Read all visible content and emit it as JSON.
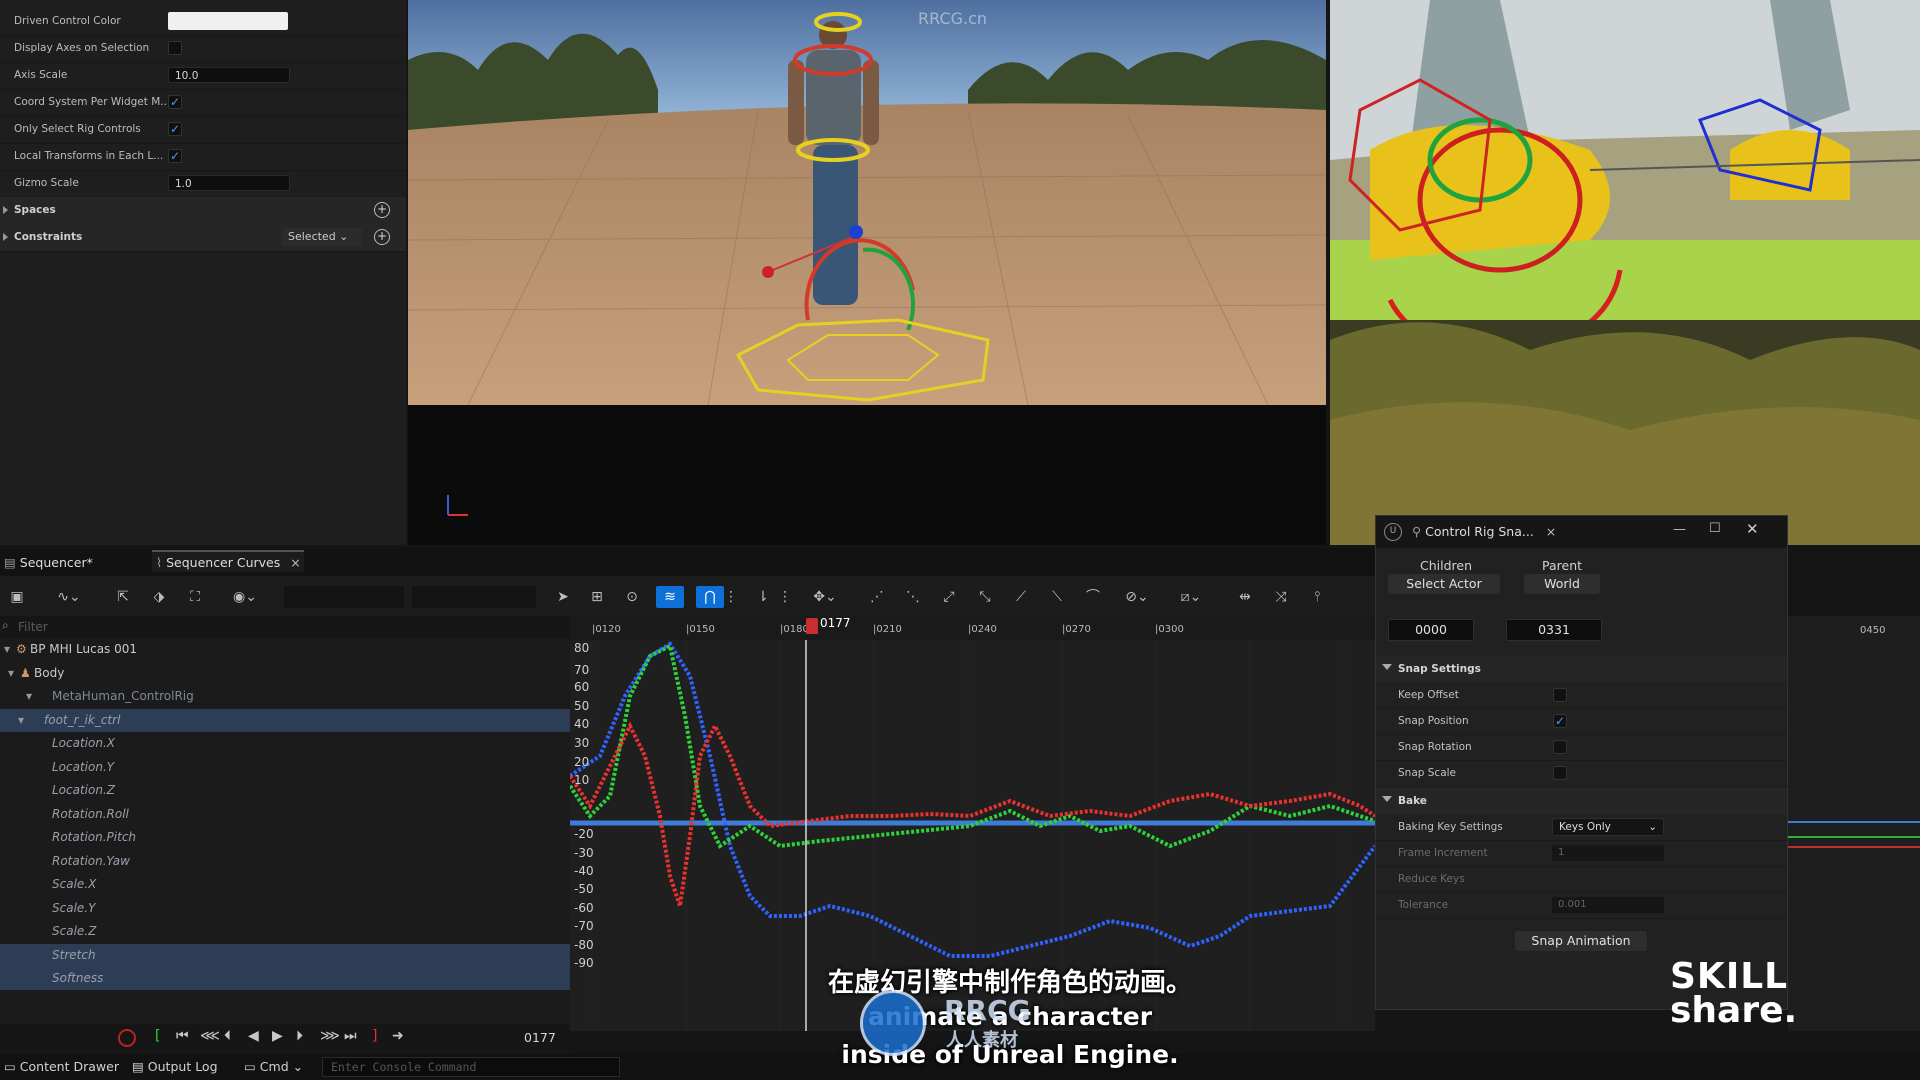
{
  "details": {
    "rows": [
      {
        "label": "Driven Control Color",
        "type": "color"
      },
      {
        "label": "Display Axes on Selection",
        "type": "check",
        "checked": false
      },
      {
        "label": "Axis Scale",
        "type": "value",
        "value": "10.0"
      },
      {
        "label": "Coord System Per Widget M...",
        "type": "check",
        "checked": true
      },
      {
        "label": "Only Select Rig Controls",
        "type": "check",
        "checked": true
      },
      {
        "label": "Local Transforms in Each L...",
        "type": "check",
        "checked": true
      },
      {
        "label": "Gizmo Scale",
        "type": "value",
        "value": "1.0"
      }
    ],
    "spaces_label": "Spaces",
    "constraints_label": "Constraints",
    "constraints_select": "Selected"
  },
  "viewport": {
    "watermark": "RRCG.cn"
  },
  "tabs": {
    "sequencer": "Sequencer*",
    "curves": "Sequencer Curves"
  },
  "filter_placeholder": "Filter",
  "outliner": [
    {
      "label": "BP MHI Lucas 001",
      "indent": 0,
      "kind": "actor"
    },
    {
      "label": "Body",
      "indent": 1,
      "kind": "body"
    },
    {
      "label": "MetaHuman_ControlRig",
      "indent": 2,
      "kind": "rig"
    },
    {
      "label": "foot_r_ik_ctrl",
      "indent": 3,
      "kind": "ctrl",
      "selected": true
    },
    {
      "label": "Location.X",
      "indent": 4,
      "kind": "channel"
    },
    {
      "label": "Location.Y",
      "indent": 4,
      "kind": "channel"
    },
    {
      "label": "Location.Z",
      "indent": 4,
      "kind": "channel"
    },
    {
      "label": "Rotation.Roll",
      "indent": 4,
      "kind": "channel"
    },
    {
      "label": "Rotation.Pitch",
      "indent": 4,
      "kind": "channel"
    },
    {
      "label": "Rotation.Yaw",
      "indent": 4,
      "kind": "channel"
    },
    {
      "label": "Scale.X",
      "indent": 4,
      "kind": "channel"
    },
    {
      "label": "Scale.Y",
      "indent": 4,
      "kind": "channel"
    },
    {
      "label": "Scale.Z",
      "indent": 4,
      "kind": "channel"
    },
    {
      "label": "Stretch",
      "indent": 4,
      "kind": "channel",
      "selected": true
    },
    {
      "label": "Softness",
      "indent": 4,
      "kind": "channel",
      "selected": true
    }
  ],
  "timeline": {
    "current_frame": "0177",
    "ticks": [
      "0120",
      "0150",
      "0180",
      "0210",
      "0240",
      "0270",
      "0300",
      "0450"
    ],
    "y_labels": [
      "80",
      "70",
      "60",
      "50",
      "40",
      "30",
      "20",
      "10",
      "-20",
      "-30",
      "-40",
      "-50",
      "-60",
      "-70",
      "-80",
      "-90"
    ]
  },
  "curves": {
    "colors": {
      "red": "#e8322f",
      "green": "#2fd13a",
      "blue": "#2f62ff",
      "flat": "#3f7cd8"
    }
  },
  "transport": {
    "frame": "0177"
  },
  "statusbar": {
    "content_drawer": "Content Drawer",
    "output_log": "Output Log",
    "cmd": "Cmd",
    "console_placeholder": "Enter Console Command"
  },
  "snap": {
    "title": "Control Rig Sna...",
    "children_label": "Children",
    "children_button": "Select Actor",
    "parent_label": "Parent",
    "parent_button": "World",
    "start_frame": "0000",
    "end_frame": "0331",
    "snap_settings_label": "Snap Settings",
    "keep_offset": "Keep Offset",
    "snap_position": "Snap Position",
    "snap_rotation": "Snap Rotation",
    "snap_scale": "Snap Scale",
    "bake_label": "Bake",
    "baking_key_settings": "Baking Key Settings",
    "baking_key_value": "Keys Only",
    "frame_increment": "Frame Increment",
    "frame_increment_value": "1",
    "reduce_keys": "Reduce Keys",
    "tolerance": "Tolerance",
    "tolerance_value": "0.001",
    "snap_animation": "Snap Animation"
  },
  "subtitles": {
    "line1": "在虚幻引擎中制作角色的动画。",
    "line2": "animate a character",
    "line3": "inside of Unreal Engine."
  },
  "overlay": {
    "skillshare_line1": "SKILL",
    "skillshare_line2": "share.",
    "rrcg_logo": "RRCG",
    "rrcg_sub": "人人素材"
  }
}
